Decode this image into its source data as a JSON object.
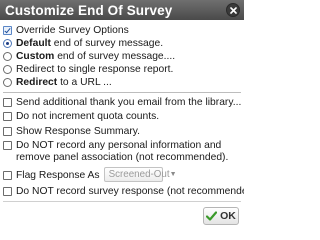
{
  "dialog": {
    "title": "Customize End Of Survey",
    "close_icon": "close-icon"
  },
  "options": {
    "override": {
      "label": "Override Survey Options",
      "checked": true
    },
    "end_messages": [
      {
        "bold": "Default",
        "rest": " end of survey message.",
        "selected": true
      },
      {
        "bold": "Custom",
        "rest": " end of survey message....",
        "selected": false
      },
      {
        "bold": "",
        "rest": "Redirect to single response report.",
        "selected": false
      },
      {
        "bold": "Redirect",
        "rest": " to a URL ...",
        "selected": false
      }
    ],
    "checkboxes": [
      {
        "label": "Send additional thank you email from the library...",
        "checked": false
      },
      {
        "label": "Do not increment quota counts.",
        "checked": false
      },
      {
        "label": "Show Response Summary.",
        "checked": false
      },
      {
        "label": "Do NOT record any personal information and remove panel association (not recommended).",
        "checked": false
      }
    ],
    "flag_response": {
      "label": "Flag Response As",
      "checked": false,
      "select_value": "Screened-Out"
    },
    "do_not_record": {
      "label": "Do NOT record survey response (not recommended).",
      "checked": false
    }
  },
  "footer": {
    "ok_label": "OK",
    "ok_icon": "checkmark-icon",
    "ok_icon_color": "#3a9a2a"
  },
  "colors": {
    "titlebar": "#5a5a5a",
    "title_text": "#ffffff"
  }
}
